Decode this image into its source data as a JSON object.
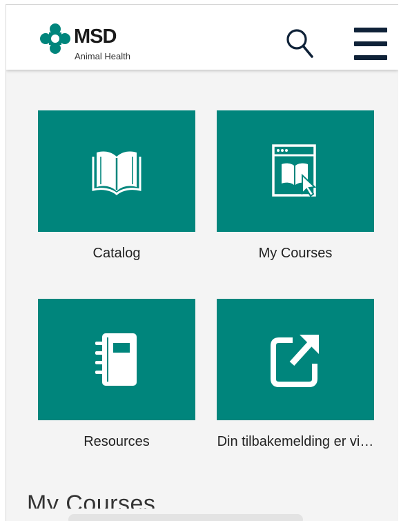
{
  "brand": {
    "name": "MSD",
    "subtitle": "Animal Health",
    "color": "#00857c"
  },
  "header": {
    "search_icon": "search-icon",
    "menu_icon": "hamburger-menu-icon"
  },
  "tiles": [
    {
      "label": "Catalog",
      "icon": "open-book-icon"
    },
    {
      "label": "My Courses",
      "icon": "course-window-icon"
    },
    {
      "label": "Resources",
      "icon": "notebook-icon"
    },
    {
      "label": "Din tilbakemelding er vi…",
      "icon": "external-link-icon"
    }
  ],
  "section": {
    "title": "My Courses"
  }
}
